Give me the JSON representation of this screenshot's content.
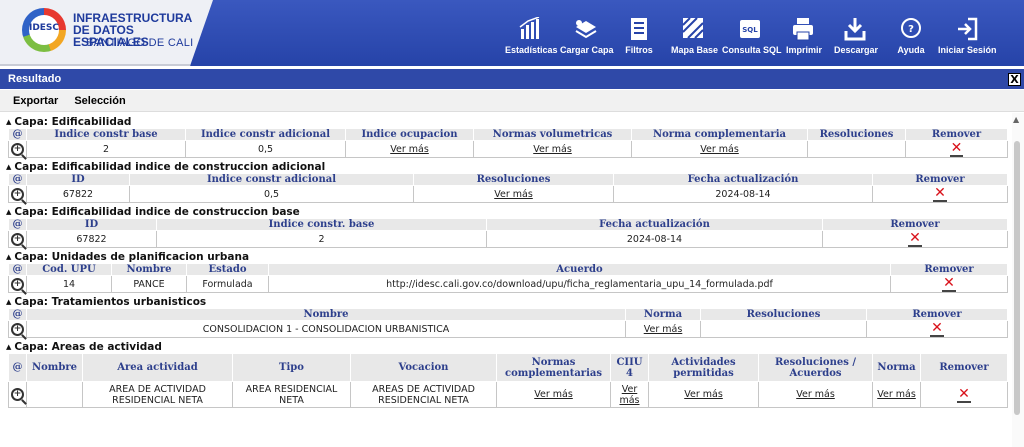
{
  "header": {
    "logo_badge": "IDESC",
    "logo_l1": "INFRAESTRUCTURA",
    "logo_l2": "DE DATOS ESPACIALES",
    "logo_l3": "SANTIAGO DE CALI"
  },
  "toolbar": [
    {
      "label": "Estadísticas",
      "icon": "bar-chart-icon"
    },
    {
      "label": "Cargar Capa",
      "icon": "layers-icon"
    },
    {
      "label": "Filtros",
      "icon": "filter-icon"
    },
    {
      "label": "Mapa Base",
      "icon": "basemap-icon"
    },
    {
      "label": "Consulta SQL",
      "icon": "sql-icon"
    },
    {
      "label": "Imprimir",
      "icon": "printer-icon"
    },
    {
      "label": "Descargar",
      "icon": "download-icon"
    },
    {
      "label": "Ayuda",
      "icon": "help-icon"
    },
    {
      "label": "Iniciar Sesión",
      "icon": "login-icon"
    }
  ],
  "result": {
    "title": "Resultado",
    "close": "X"
  },
  "menu": {
    "exportar": "Exportar",
    "seleccion": "Selección"
  },
  "zoom_col": "@",
  "remove_col": "Remover",
  "capas": [
    {
      "title": "Capa: Edificabilidad",
      "cols": [
        "Indice constr base",
        "Indice constr adicional",
        "Indice ocupacion",
        "Normas volumetricas",
        "Norma complementaria",
        "Resoluciones"
      ],
      "row": [
        "2",
        "0,5",
        "Ver más",
        "Ver más",
        "Ver más",
        ""
      ]
    },
    {
      "title": "Capa: Edificabilidad indice de construccion adicional",
      "cols": [
        "ID",
        "Indice constr adicional",
        "Resoluciones",
        "Fecha actualización"
      ],
      "row": [
        "67822",
        "0,5",
        "Ver más",
        "2024-08-14"
      ]
    },
    {
      "title": "Capa: Edificabilidad indice de construccion base",
      "cols": [
        "ID",
        "Indice constr. base",
        "Fecha actualización"
      ],
      "row": [
        "67822",
        "2",
        "2024-08-14"
      ]
    },
    {
      "title": "Capa: Unidades de planificacion urbana",
      "cols": [
        "Cod. UPU",
        "Nombre",
        "Estado",
        "Acuerdo"
      ],
      "row": [
        "14",
        "PANCE",
        "Formulada",
        "http://idesc.cali.gov.co/download/upu/ficha_reglamentaria_upu_14_formulada.pdf"
      ]
    },
    {
      "title": "Capa: Tratamientos urbanisticos",
      "cols": [
        "Nombre",
        "Norma",
        "Resoluciones"
      ],
      "row": [
        "CONSOLIDACION 1 - CONSOLIDACION URBANISTICA",
        "Ver más",
        ""
      ]
    },
    {
      "title": "Capa: Areas de actividad",
      "cols": [
        "Nombre",
        "Area actividad",
        "Tipo",
        "Vocacion",
        "Normas complementarias",
        "CIIU 4",
        "Actividades permitidas",
        "Resoluciones / Acuerdos",
        "Norma"
      ],
      "row": [
        "",
        "AREA DE ACTIVIDAD RESIDENCIAL NETA",
        "AREA RESIDENCIAL NETA",
        "AREAS DE ACTIVIDAD RESIDENCIAL NETA",
        "Ver más",
        "Ver más",
        "Ver más",
        "Ver más",
        "Ver más"
      ]
    }
  ]
}
